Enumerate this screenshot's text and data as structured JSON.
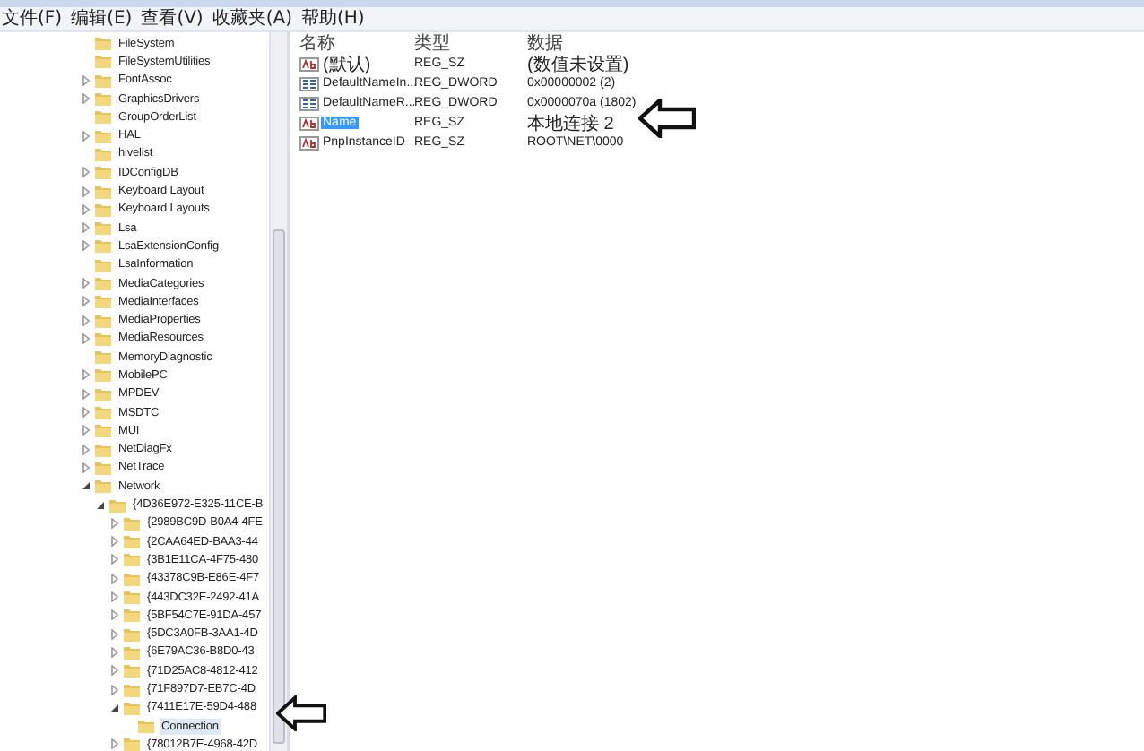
{
  "menu": [
    "文件(F)",
    "编辑(E)",
    "查看(V)",
    "收藏夹(A)",
    "帮助(H)"
  ],
  "tree": [
    {
      "name": "FileSystem"
    },
    {
      "name": "FileSystemUtilities"
    },
    {
      "name": "FontAssoc",
      "expanded": false
    },
    {
      "name": "GraphicsDrivers",
      "expanded": false
    },
    {
      "name": "GroupOrderList"
    },
    {
      "name": "HAL",
      "expanded": false
    },
    {
      "name": "hivelist"
    },
    {
      "name": "IDConfigDB",
      "expanded": false
    },
    {
      "name": "Keyboard Layout",
      "expanded": false
    },
    {
      "name": "Keyboard Layouts",
      "expanded": false
    },
    {
      "name": "Lsa",
      "expanded": false
    },
    {
      "name": "LsaExtensionConfig",
      "expanded": false
    },
    {
      "name": "LsaInformation"
    },
    {
      "name": "MediaCategories",
      "expanded": false
    },
    {
      "name": "MediaInterfaces",
      "expanded": false
    },
    {
      "name": "MediaProperties",
      "expanded": false
    },
    {
      "name": "MediaResources",
      "expanded": false
    },
    {
      "name": "MemoryDiagnostic"
    },
    {
      "name": "MobilePC",
      "expanded": false
    },
    {
      "name": "MPDEV",
      "expanded": false
    },
    {
      "name": "MSDTC",
      "expanded": false
    },
    {
      "name": "MUI",
      "expanded": false
    },
    {
      "name": "NetDiagFx",
      "expanded": false
    },
    {
      "name": "NetTrace",
      "expanded": false
    },
    {
      "name": "Network",
      "expanded": true,
      "children": [
        {
          "name": "{4D36E972-E325-11CE-B",
          "expanded": true,
          "children": [
            {
              "name": "{2989BC9D-B0A4-4FE",
              "expanded": false
            },
            {
              "name": "{2CAA64ED-BAA3-44",
              "expanded": false
            },
            {
              "name": "{3B1E11CA-4F75-480",
              "expanded": false
            },
            {
              "name": "{43378C9B-E86E-4F7",
              "expanded": false
            },
            {
              "name": "{443DC32E-2492-41A",
              "expanded": false
            },
            {
              "name": "{5BF54C7E-91DA-457",
              "expanded": false
            },
            {
              "name": "{5DC3A0FB-3AA1-4D",
              "expanded": false
            },
            {
              "name": "{6E79AC36-B8D0-43",
              "expanded": false
            },
            {
              "name": "{71D25AC8-4812-412",
              "expanded": false
            },
            {
              "name": "{71F897D7-EB7C-4D",
              "expanded": false
            },
            {
              "name": "{7411E17E-59D4-488",
              "expanded": true,
              "children": [
                {
                  "name": "Connection",
                  "selected": true
                }
              ]
            },
            {
              "name": "{78012B7E-4968-42D",
              "expanded": false
            }
          ]
        }
      ]
    }
  ],
  "values": {
    "columns": [
      "名称",
      "类型",
      "数据"
    ],
    "rows": [
      {
        "kind": "string",
        "name": "(默认)",
        "type": "REG_SZ",
        "data": "(数值未设置)",
        "selected": false
      },
      {
        "kind": "binary",
        "name": "DefaultNameIn...",
        "type": "REG_DWORD",
        "data": "0x00000002 (2)",
        "selected": false
      },
      {
        "kind": "binary",
        "name": "DefaultNameR...",
        "type": "REG_DWORD",
        "data": "0x0000070a (1802)",
        "selected": false
      },
      {
        "kind": "string",
        "name": "Name",
        "type": "REG_SZ",
        "data": "本地连接 2",
        "selected": true
      },
      {
        "kind": "string",
        "name": "PnpInstanceID",
        "type": "REG_SZ",
        "data": "ROOT\\NET\\0000",
        "selected": false
      }
    ]
  }
}
